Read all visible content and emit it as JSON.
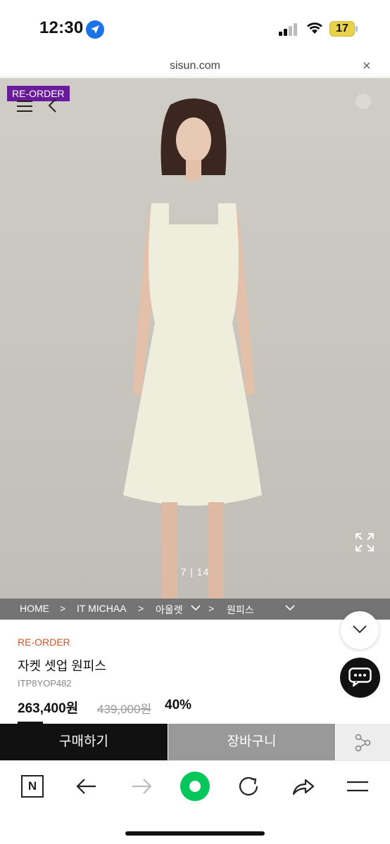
{
  "status_bar": {
    "time": "12:30",
    "battery_level": "17",
    "battery_fraction": 0.17
  },
  "url_bar": {
    "url": "sisun.com",
    "close_label": "×"
  },
  "product_image": {
    "tag": "RE-ORDER",
    "counter": "7 | 14"
  },
  "breadcrumb": {
    "items": [
      "HOME",
      "IT MICHAA",
      "아울렛",
      "원피스"
    ],
    "separator": ">"
  },
  "product": {
    "tag": "RE-ORDER",
    "name": "자켓 셋업 원피스",
    "code": "ITP8YOP482",
    "price": "263,400원",
    "original_price": "439,000원",
    "discount": "40%"
  },
  "actions": {
    "buy_label": "구매하기",
    "cart_label": "장바구니"
  },
  "icons": {
    "location": "location-arrow-icon",
    "menu": "hamburger-menu-icon",
    "back": "chevron-left-icon",
    "expand": "expand-icon",
    "scroll_down": "chevron-down-icon",
    "chat": "chat-bubble-icon",
    "share": "share-nodes-icon",
    "naver": "naver-n-icon",
    "browser_back": "arrow-left-icon",
    "browser_forward": "arrow-right-icon",
    "naver_home": "green-dot-icon",
    "reload": "reload-icon",
    "browser_share": "share-arrow-icon",
    "browser_menu": "menu-lines-icon"
  },
  "colors": {
    "reorder_tag_bg": "#6a1b9a",
    "reorder_text": "#d2572b",
    "naver_green": "#03c75a",
    "buy_button_bg": "#111111",
    "cart_button_bg": "#999999"
  },
  "toolbar": {
    "naver_letter": "N"
  }
}
